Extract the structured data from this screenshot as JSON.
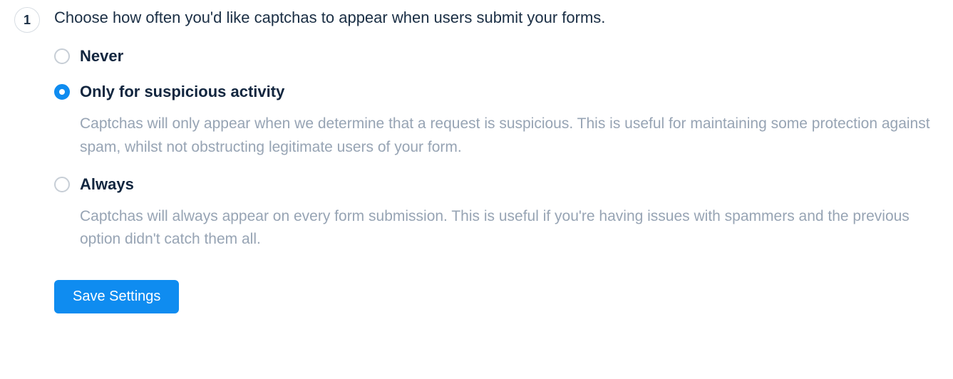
{
  "step": {
    "number": "1",
    "title": "Choose how often you'd like captchas to appear when users submit your forms."
  },
  "options": [
    {
      "key": "never",
      "label": "Never",
      "description": "",
      "selected": false
    },
    {
      "key": "suspicious",
      "label": "Only for suspicious activity",
      "description": "Captchas will only appear when we determine that a request is suspicious. This is useful for maintaining some protection against spam, whilst not obstructing legitimate users of your form.",
      "selected": true
    },
    {
      "key": "always",
      "label": "Always",
      "description": "Captchas will always appear on every form submission. This is useful if you're having issues with spammers and the previous option didn't catch them all.",
      "selected": false
    }
  ],
  "actions": {
    "save_label": "Save Settings"
  }
}
